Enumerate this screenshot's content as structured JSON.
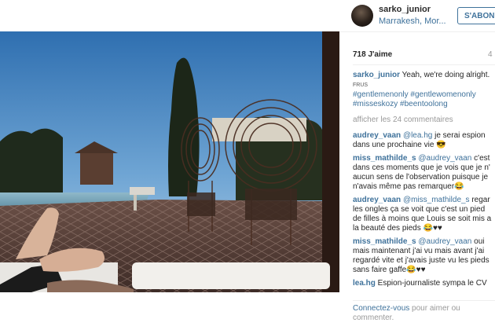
{
  "post": {
    "username": "sarko_junior",
    "location": "Marrakesh, Mor...",
    "follow_label": "S'ABONNER",
    "likes": "718 J'aime",
    "time_ago": "4"
  },
  "caption": {
    "user": "sarko_junior",
    "text": "Yeah, we're doing alright.",
    "small_text": "FRUS",
    "hashtags": [
      "#gentlemenonly #gentlewomenonly",
      "#misseskozy #beentoolong"
    ]
  },
  "more_comments": "afficher les 24 commentaires",
  "comments": [
    {
      "user": "audrey_vaan",
      "mention": "@lea.hg",
      "lines": [
        " je serai espion",
        "dans une prochaine vie 😎"
      ]
    },
    {
      "user": "miss_mathilde_s",
      "mention": "@audrey_vaan",
      "lines": [
        " c'est",
        "dans ces moments que je vois que je n'",
        "aucun sens de l'observation puisque je",
        "n'avais même pas remarquer😂"
      ]
    },
    {
      "user": "audrey_vaan",
      "mention": "@miss_mathilde_s",
      "lines": [
        " regar",
        "les ongles ça se voit que c'est un pied",
        "de filles à moins que Louis se soit mis a",
        "la beauté des pieds 😂♥♥"
      ]
    },
    {
      "user": "miss_mathilde_s",
      "mention": "@audrey_vaan",
      "lines": [
        " oui",
        "mais maintenant j'ai vu mais avant j'ai",
        "regardé vite et j'avais juste vu les pieds",
        "sans faire gaffe😂♥♥"
      ]
    },
    {
      "user": "lea.hg",
      "mention": "",
      "lines": [
        " Espion-journaliste sympa le CV"
      ]
    }
  ],
  "cta": {
    "link": "Connectez-vous",
    "rest": " pour aimer ou",
    "line2": "commenter."
  }
}
